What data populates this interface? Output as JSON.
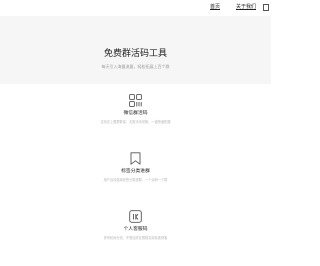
{
  "nav": {
    "home_label": "首页",
    "about_label": "关于我们"
  },
  "hero": {
    "title": "免费群活码工具",
    "subtitle": "每天引入海量流量，轻松拓展上百个群"
  },
  "features": [
    {
      "icon": "qr-code-icon",
      "title": "微信群活码",
      "desc": "支持无上限群数量，无需手动切换，一键快速拓展"
    },
    {
      "icon": "bookmark-icon",
      "title": "标签分类进群",
      "desc": "用户自动选择标签分类进群，一个活码一个群"
    },
    {
      "icon": "personal-code-icon",
      "title": "个人客服码",
      "desc": "多号轮询分流，不受加好友限制高效精准获客"
    }
  ]
}
